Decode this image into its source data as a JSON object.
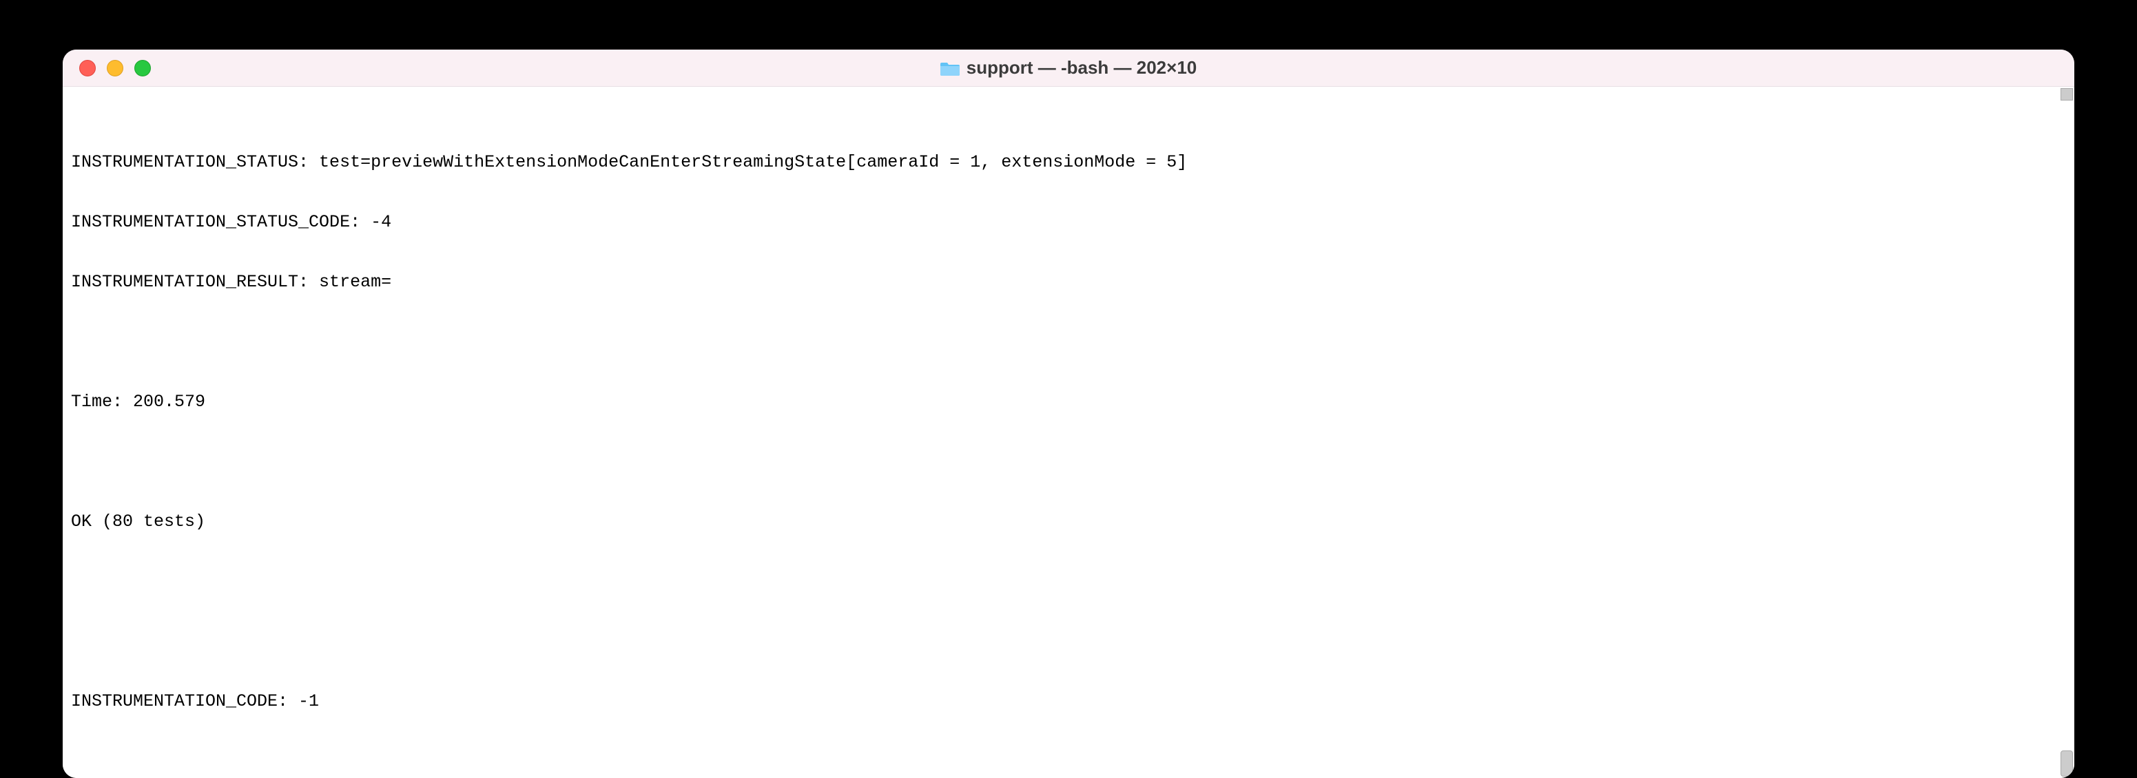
{
  "window": {
    "title": "support — -bash — 202×10"
  },
  "terminal": {
    "lines": [
      "INSTRUMENTATION_STATUS: test=previewWithExtensionModeCanEnterStreamingState[cameraId = 1, extensionMode = 5]",
      "INSTRUMENTATION_STATUS_CODE: -4",
      "INSTRUMENTATION_RESULT: stream=",
      "",
      "Time: 200.579",
      "",
      "OK (80 tests)",
      "",
      "",
      "INSTRUMENTATION_CODE: -1"
    ]
  }
}
